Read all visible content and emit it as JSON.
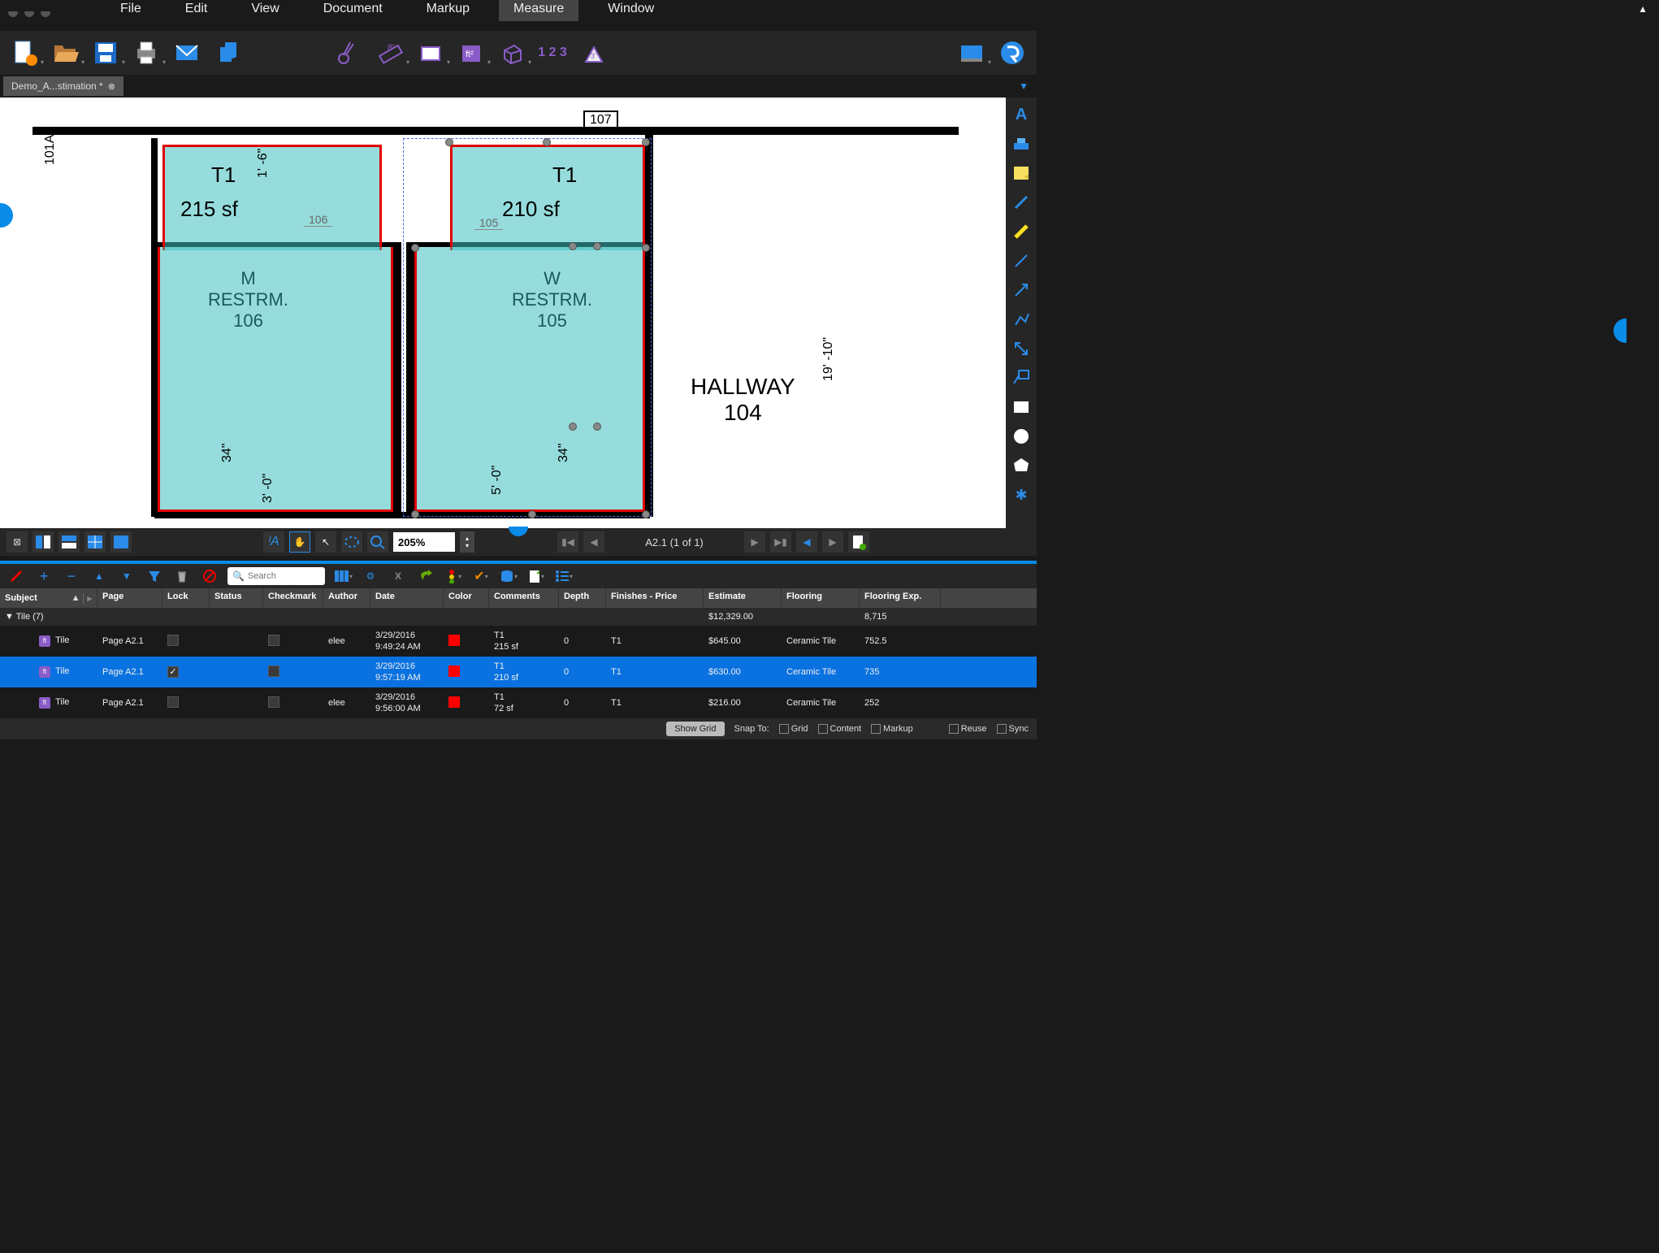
{
  "menu": {
    "items": [
      "File",
      "Edit",
      "View",
      "Document",
      "Markup",
      "Measure",
      "Window"
    ],
    "active": "Measure"
  },
  "tab": {
    "title": "Demo_A...stimation *"
  },
  "toolbar": {
    "meas_123": "1 2 3"
  },
  "floorplan": {
    "t1a": {
      "tag": "T1",
      "area": "215 sf"
    },
    "t1b": {
      "tag": "T1",
      "area": "210 sf"
    },
    "room_m": {
      "line1": "M",
      "line2": "RESTRM.",
      "line3": "106"
    },
    "room_w": {
      "line1": "W",
      "line2": "RESTRM.",
      "line3": "105"
    },
    "hallway": {
      "line1": "HALLWAY",
      "line2": "104"
    },
    "door_105": "105",
    "door_106": "106",
    "door_107": "107",
    "door_101a": "101A",
    "dim_19_10": "19' -10\"",
    "dim_34a": "34\"",
    "dim_34b": "34\"",
    "dim_3_0": "3' -0\"",
    "dim_5_0": "5' -0\"",
    "dim_1_6": "1' -6\""
  },
  "nav": {
    "zoom": "205%",
    "page_ind": "A2.1 (1 of 1)"
  },
  "markup_tb": {
    "search_ph": "Search"
  },
  "table": {
    "headers": {
      "subject": "Subject",
      "page": "Page",
      "lock": "Lock",
      "status": "Status",
      "checkmark": "Checkmark",
      "author": "Author",
      "date": "Date",
      "color": "Color",
      "comments": "Comments",
      "depth": "Depth",
      "finishes": "Finishes - Price",
      "estimate": "Estimate",
      "flooring": "Flooring",
      "flooring_exp": "Flooring Exp."
    },
    "group": {
      "label": "Tile (7)",
      "estimate": "$12,329.00",
      "flooring_exp": "8,715"
    },
    "rows": [
      {
        "subject": "Tile",
        "page": "Page A2.1",
        "lock": false,
        "author": "elee",
        "date_d": "3/29/2016",
        "date_t": "9:49:24 AM",
        "comments_l1": "T1",
        "comments_l2": "215 sf",
        "depth": "0",
        "finishes": "T1",
        "estimate": "$645.00",
        "flooring": "Ceramic Tile",
        "flooring_exp": "752.5",
        "selected": false
      },
      {
        "subject": "Tile",
        "page": "Page A2.1",
        "lock": true,
        "author": "",
        "date_d": "3/29/2016",
        "date_t": "9:57:19 AM",
        "comments_l1": "T1",
        "comments_l2": "210 sf",
        "depth": "0",
        "finishes": "T1",
        "estimate": "$630.00",
        "flooring": "Ceramic Tile",
        "flooring_exp": "735",
        "selected": true
      },
      {
        "subject": "Tile",
        "page": "Page A2.1",
        "lock": false,
        "author": "elee",
        "date_d": "3/29/2016",
        "date_t": "9:56:00 AM",
        "comments_l1": "T1",
        "comments_l2": "72 sf",
        "depth": "0",
        "finishes": "T1",
        "estimate": "$216.00",
        "flooring": "Ceramic Tile",
        "flooring_exp": "252",
        "selected": false
      }
    ]
  },
  "footer": {
    "show_grid": "Show Grid",
    "snap_to": "Snap To:",
    "grid": "Grid",
    "content": "Content",
    "markup": "Markup",
    "reuse": "Reuse",
    "sync": "Sync"
  }
}
